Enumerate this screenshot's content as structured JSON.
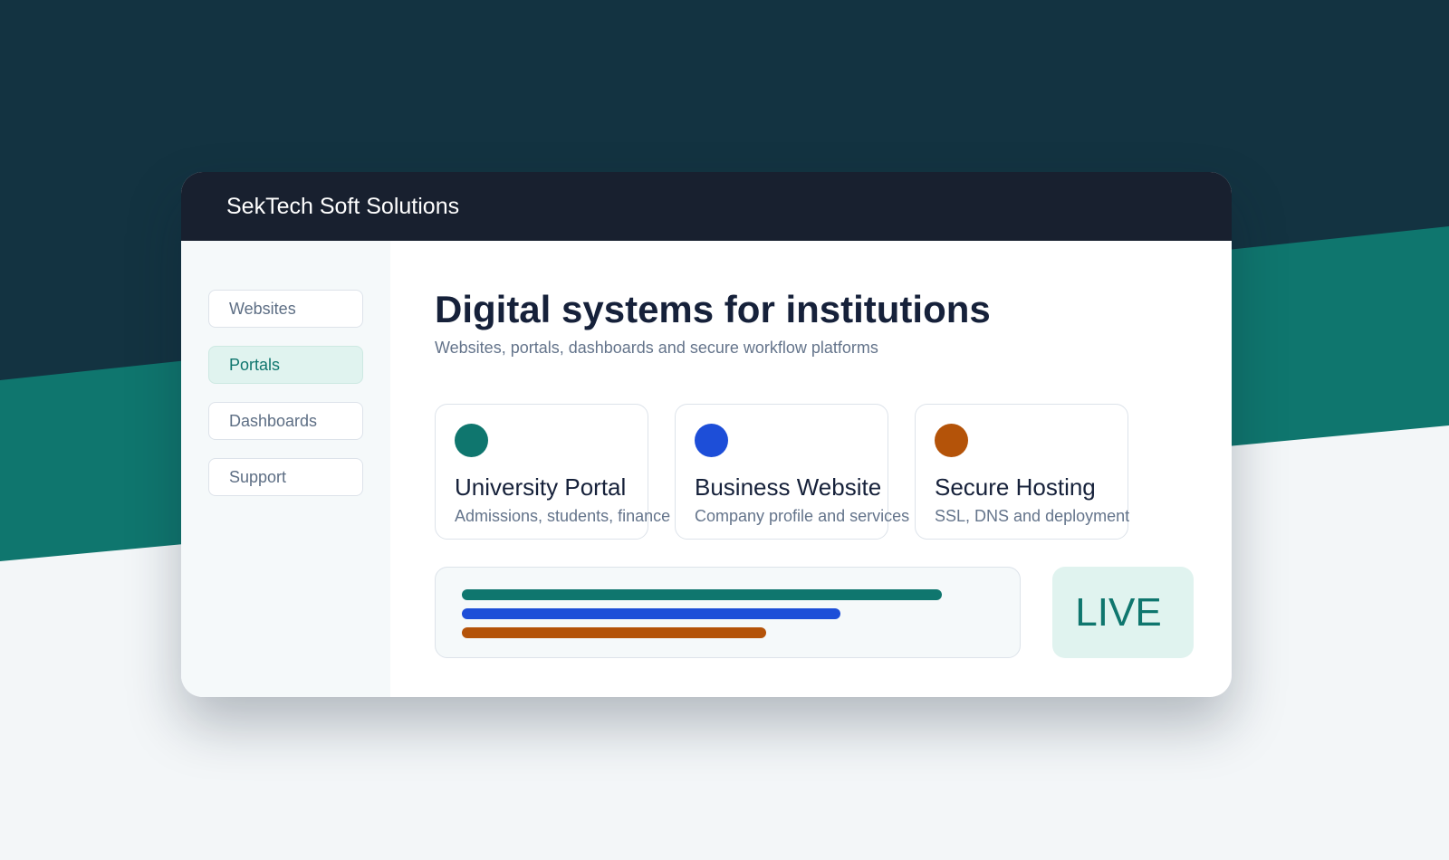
{
  "colors": {
    "background_dark": "#133341",
    "background_teal": "#0f766e",
    "background_light": "#f3f6f8",
    "titlebar": "#18202f",
    "accent": "#0f766e"
  },
  "window": {
    "title": "SekTech Soft Solutions"
  },
  "sidebar": {
    "items": [
      {
        "label": "Websites",
        "active": false
      },
      {
        "label": "Portals",
        "active": true
      },
      {
        "label": "Dashboards",
        "active": false
      },
      {
        "label": "Support",
        "active": false
      }
    ]
  },
  "main": {
    "headline": "Digital systems for institutions",
    "subhead": "Websites, portals, dashboards and secure workflow platforms",
    "cards": [
      {
        "title": "University Portal",
        "description": "Admissions, students, finance",
        "color": "#0f766e",
        "icon": "teal-dot-icon"
      },
      {
        "title": "Business Website",
        "description": "Company profile and services",
        "color": "#1d4ed8",
        "icon": "blue-dot-icon"
      },
      {
        "title": "Secure Hosting",
        "description": "SSL, DNS and deployment",
        "color": "#b45309",
        "icon": "orange-dot-icon"
      }
    ],
    "progress_bars": [
      {
        "color": "#0f766e",
        "fraction": 0.9
      },
      {
        "color": "#1d4ed8",
        "fraction": 0.71
      },
      {
        "color": "#b45309",
        "fraction": 0.57
      }
    ],
    "live_badge": "LIVE"
  }
}
